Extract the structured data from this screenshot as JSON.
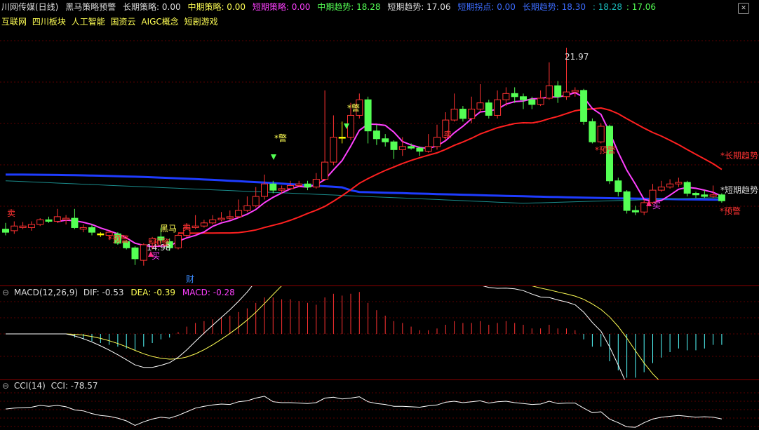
{
  "header": {
    "stock_name": "川网传媒(日线)",
    "indicator_name": "黑马策略预警",
    "long_label": "长期策略: 0.00",
    "mid_label": "中期策略: 0.00",
    "short_label": "短期策略: 0.00",
    "mid_trend": "中期趋势: 18.28",
    "short_trend": "短期趋势: 17.06",
    "short_pivot": "短期拐点: 0.00",
    "long_trend": "长期趋势: 18.30",
    "v1": ": 18.28",
    "v2": ": 17.06"
  },
  "tags": [
    "互联网",
    "四川板块",
    "人工智能",
    "国资云",
    "AIGC概念",
    "短剧游戏"
  ],
  "colors": {
    "up": "#ff3232",
    "down": "#54ff54",
    "flat": "#ffff00",
    "long_line": "#1e3cff",
    "mid_line": "#ff2020",
    "short_line": "#ff40ff",
    "teal": "#1a8b8b"
  },
  "annotations": {
    "high_label": "21.97",
    "low_label": "14.98",
    "heima": "黑马",
    "warn": "*预警",
    "jing": "*警",
    "buy": "买",
    "sell": "卖",
    "cai": "财",
    "long_trend_tag": "*长期趋势",
    "short_trend_tag": "*短期趋势"
  },
  "macd": {
    "title": "MACD(12,26,9)",
    "dif": "DIF: -0.53",
    "dea": "DEA: -0.39",
    "macd": "MACD: -0.28"
  },
  "cci": {
    "title": "CCI(14)",
    "value": "CCI: -78.57"
  },
  "chart_data": {
    "type": "candlestick",
    "candles": [
      [
        16.15,
        16.05,
        16.35,
        15.95
      ],
      [
        16.1,
        16.25,
        16.4,
        16.0
      ],
      [
        16.2,
        16.25,
        16.38,
        16.15
      ],
      [
        16.2,
        16.3,
        16.4,
        16.1
      ],
      [
        16.3,
        16.45,
        16.5,
        16.25
      ],
      [
        16.45,
        16.4,
        16.55,
        16.35
      ],
      [
        16.4,
        16.55,
        16.8,
        16.35
      ],
      [
        16.45,
        16.5,
        16.6,
        16.3
      ],
      [
        16.5,
        16.2,
        16.8,
        16.15
      ],
      [
        16.15,
        16.2,
        16.3,
        16.05
      ],
      [
        16.2,
        16.05,
        16.3,
        15.95
      ],
      [
        16.0,
        16.0,
        16.05,
        15.9
      ],
      [
        15.95,
        16.05,
        16.1,
        15.8
      ],
      [
        16.0,
        15.7,
        16.05,
        15.65
      ],
      [
        15.75,
        15.55,
        15.8,
        15.5
      ],
      [
        15.55,
        15.2,
        15.6,
        15.0
      ],
      [
        15.15,
        15.65,
        15.7,
        14.98
      ],
      [
        15.7,
        15.85,
        15.9,
        15.5
      ],
      [
        15.9,
        15.8,
        16.2,
        15.7
      ],
      [
        15.75,
        15.55,
        15.85,
        15.45
      ],
      [
        15.55,
        15.95,
        16.0,
        15.5
      ],
      [
        15.95,
        16.2,
        16.3,
        15.9
      ],
      [
        16.2,
        16.25,
        16.6,
        16.15
      ],
      [
        16.25,
        16.35,
        16.45,
        16.2
      ],
      [
        16.35,
        16.45,
        16.6,
        16.3
      ],
      [
        16.45,
        16.5,
        16.7,
        16.4
      ],
      [
        16.5,
        16.55,
        16.75,
        16.45
      ],
      [
        16.55,
        16.75,
        17.1,
        16.5
      ],
      [
        16.75,
        16.9,
        17.2,
        16.7
      ],
      [
        16.9,
        17.2,
        17.5,
        16.85
      ],
      [
        17.2,
        17.6,
        17.9,
        17.1
      ],
      [
        17.6,
        17.4,
        17.7,
        17.3
      ],
      [
        17.4,
        17.45,
        17.55,
        17.3
      ],
      [
        17.45,
        17.55,
        17.7,
        17.4
      ],
      [
        17.55,
        17.6,
        17.7,
        17.5
      ],
      [
        17.6,
        17.5,
        17.7,
        17.4
      ],
      [
        17.5,
        17.75,
        17.95,
        17.45
      ],
      [
        17.75,
        18.3,
        20.6,
        17.7
      ],
      [
        18.3,
        19.1,
        19.8,
        18.2
      ],
      [
        19.1,
        19.1,
        19.6,
        18.9
      ],
      [
        19.1,
        19.8,
        20.2,
        19.0
      ],
      [
        19.8,
        20.3,
        20.5,
        19.7
      ],
      [
        20.3,
        19.3,
        20.4,
        18.9
      ],
      [
        19.3,
        19.05,
        19.5,
        18.85
      ],
      [
        19.05,
        18.95,
        19.2,
        18.8
      ],
      [
        18.95,
        18.7,
        19.0,
        18.4
      ],
      [
        18.7,
        18.8,
        19.1,
        18.5
      ],
      [
        18.8,
        18.75,
        18.9,
        18.7
      ],
      [
        18.75,
        18.65,
        18.8,
        18.5
      ],
      [
        18.65,
        18.8,
        19.2,
        18.6
      ],
      [
        18.8,
        19.1,
        19.5,
        18.7
      ],
      [
        19.1,
        19.65,
        19.9,
        19.0
      ],
      [
        19.65,
        20.0,
        20.5,
        19.6
      ],
      [
        20.0,
        19.7,
        20.1,
        19.6
      ],
      [
        19.7,
        20.0,
        20.4,
        19.55
      ],
      [
        20.0,
        20.2,
        20.8,
        19.9
      ],
      [
        20.2,
        19.8,
        20.3,
        19.7
      ],
      [
        19.8,
        20.3,
        20.6,
        19.7
      ],
      [
        20.3,
        20.5,
        20.7,
        20.1
      ],
      [
        20.5,
        20.4,
        20.7,
        20.2
      ],
      [
        20.4,
        20.3,
        20.5,
        20.0
      ],
      [
        20.3,
        20.15,
        20.4,
        20.0
      ],
      [
        20.15,
        20.35,
        20.6,
        20.1
      ],
      [
        20.35,
        20.75,
        21.5,
        20.3
      ],
      [
        20.75,
        20.4,
        20.9,
        20.2
      ],
      [
        20.4,
        20.55,
        21.97,
        20.3
      ],
      [
        20.55,
        20.6,
        20.7,
        20.4
      ],
      [
        20.6,
        19.6,
        20.65,
        19.5
      ],
      [
        19.6,
        18.95,
        19.7,
        18.9
      ],
      [
        18.95,
        19.45,
        19.55,
        18.9
      ],
      [
        19.45,
        17.7,
        19.5,
        17.6
      ],
      [
        17.7,
        17.35,
        17.8,
        17.2
      ],
      [
        17.35,
        16.75,
        17.4,
        16.65
      ],
      [
        16.75,
        16.7,
        16.9,
        16.6
      ],
      [
        16.7,
        17.0,
        17.1,
        16.6
      ],
      [
        17.0,
        17.4,
        17.6,
        16.95
      ],
      [
        17.4,
        17.5,
        17.7,
        17.35
      ],
      [
        17.5,
        17.6,
        17.75,
        17.45
      ],
      [
        17.6,
        17.65,
        17.8,
        17.5
      ],
      [
        17.65,
        17.3,
        17.7,
        17.2
      ],
      [
        17.3,
        17.25,
        17.35,
        17.15
      ],
      [
        17.25,
        17.2,
        17.4,
        17.15
      ],
      [
        17.2,
        17.25,
        17.55,
        17.15
      ],
      [
        17.25,
        17.06,
        17.3,
        17.0
      ]
    ],
    "macd_hist": [
      0,
      0,
      0,
      0,
      0,
      0,
      0,
      0,
      -0.02,
      -0.03,
      -0.04,
      -0.05,
      -0.06,
      -0.07,
      -0.08,
      -0.09,
      -0.07,
      -0.05,
      -0.03,
      -0.02,
      0.01,
      0.04,
      0.06,
      0.07,
      0.08,
      0.09,
      0.1,
      0.12,
      0.14,
      0.17,
      0.2,
      0.2,
      0.19,
      0.19,
      0.18,
      0.17,
      0.16,
      0.2,
      0.22,
      0.21,
      0.22,
      0.23,
      0.17,
      0.13,
      0.1,
      0.07,
      0.06,
      0.04,
      0.02,
      0.02,
      0.03,
      0.05,
      0.07,
      0.06,
      0.06,
      0.07,
      0.05,
      0.06,
      0.07,
      0.06,
      0.05,
      0.03,
      0.03,
      0.05,
      0.03,
      0.03,
      0.02,
      -0.03,
      -0.07,
      -0.07,
      -0.15,
      -0.2,
      -0.24,
      -0.24,
      -0.21,
      -0.16,
      -0.13,
      -0.1,
      -0.08,
      -0.09,
      -0.09,
      -0.08,
      -0.06,
      -0.06
    ],
    "cci": [
      30,
      40,
      45,
      50,
      70,
      60,
      70,
      55,
      20,
      10,
      -20,
      -40,
      -50,
      -70,
      -100,
      -150,
      -110,
      -80,
      -60,
      -70,
      -40,
      0,
      40,
      60,
      75,
      85,
      80,
      110,
      120,
      150,
      170,
      110,
      100,
      100,
      95,
      90,
      100,
      150,
      160,
      140,
      150,
      165,
      110,
      90,
      80,
      60,
      60,
      55,
      50,
      65,
      75,
      105,
      115,
      100,
      110,
      120,
      95,
      110,
      115,
      100,
      90,
      80,
      85,
      115,
      90,
      95,
      95,
      40,
      -10,
      0,
      -80,
      -120,
      -165,
      -170,
      -120,
      -80,
      -60,
      -50,
      -40,
      -50,
      -60,
      -55,
      -60,
      -78.57
    ]
  }
}
